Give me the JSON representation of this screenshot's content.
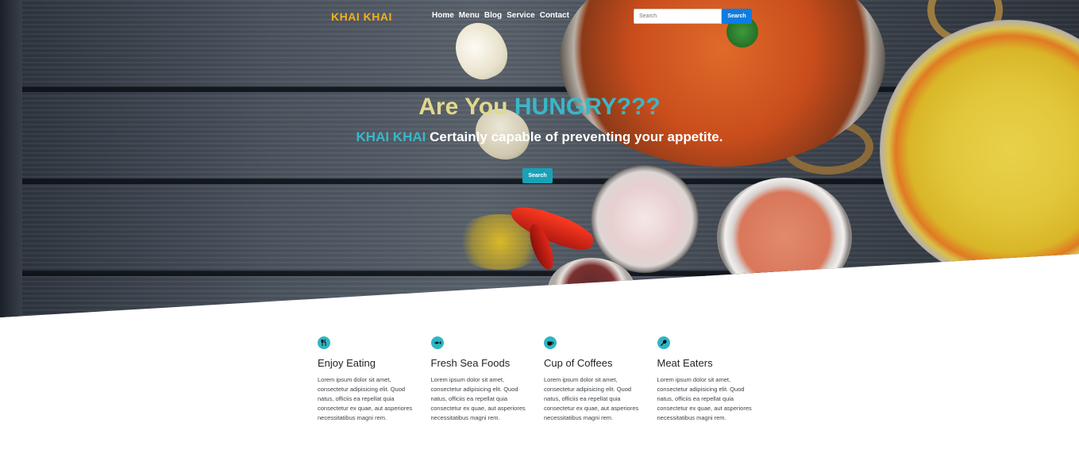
{
  "nav": {
    "brand": "KHAI KHAI",
    "links": [
      "Home",
      "Menu",
      "Blog",
      "Service",
      "Contact"
    ],
    "search_placeholder": "Search",
    "search_button": "Search"
  },
  "hero": {
    "title_part1": "Are You ",
    "title_part2": "HUNGRY???",
    "subtitle_brand": "KHAI KHAI",
    "subtitle_text": " Certainly capable of preventing your appetite.",
    "button": "Search"
  },
  "features": [
    {
      "icon": "utensils-icon",
      "title": "Enjoy Eating",
      "text": "Lorem ipsum dolor sit amet, consectetur adipisicing elit. Quod natus, officiis ea repellat quia consectetur ex quae, aut asperiores necessitatibus magni rem."
    },
    {
      "icon": "fish-icon",
      "title": "Fresh Sea Foods",
      "text": "Lorem ipsum dolor sit amet, consectetur adipisicing elit. Quod natus, officiis ea repellat quia consectetur ex quae, aut asperiores necessitatibus magni rem."
    },
    {
      "icon": "coffee-icon",
      "title": "Cup of Coffees",
      "text": "Lorem ipsum dolor sit amet, consectetur adipisicing elit. Quod natus, officiis ea repellat quia consectetur ex quae, aut asperiores necessitatibus magni rem."
    },
    {
      "icon": "drumstick-icon",
      "title": "Meat Eaters",
      "text": "Lorem ipsum dolor sit amet, consectetur adipisicing elit. Quod natus, officiis ea repellat quia consectetur ex quae, aut asperiores necessitatibus magni rem."
    }
  ],
  "colors": {
    "brand": "#f2b01e",
    "accent": "#3ab7c8",
    "nav_button": "#0d7de3",
    "hero_button": "#17a2b8"
  }
}
